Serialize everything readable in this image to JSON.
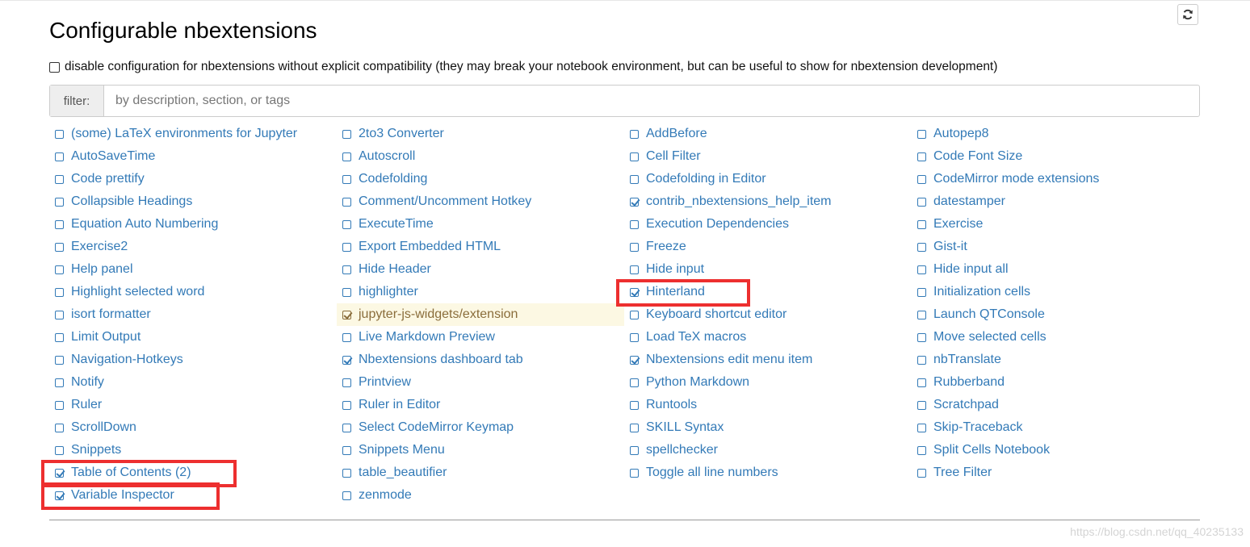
{
  "page": {
    "title": "Configurable nbextensions",
    "refresh_icon": "refresh-icon"
  },
  "disable_option": {
    "checked": false,
    "label": "disable configuration for nbextensions without explicit compatibility (they may break your notebook environment, but can be useful to show for nbextension development)"
  },
  "filter": {
    "label": "filter:",
    "placeholder": "by description, section, or tags",
    "value": ""
  },
  "colors": {
    "link": "#337ab7",
    "warning_bg": "#fcf8e3",
    "warning_text": "#8a6d3b",
    "highlight_box": "#ed2f2f"
  },
  "extensions": [
    {
      "label": "(some) LaTeX environments for Jupyter",
      "checked": false
    },
    {
      "label": "2to3 Converter",
      "checked": false
    },
    {
      "label": "AddBefore",
      "checked": false
    },
    {
      "label": "Autopep8",
      "checked": false
    },
    {
      "label": "AutoSaveTime",
      "checked": false
    },
    {
      "label": "Autoscroll",
      "checked": false
    },
    {
      "label": "Cell Filter",
      "checked": false
    },
    {
      "label": "Code Font Size",
      "checked": false
    },
    {
      "label": "Code prettify",
      "checked": false
    },
    {
      "label": "Codefolding",
      "checked": false
    },
    {
      "label": "Codefolding in Editor",
      "checked": false
    },
    {
      "label": "CodeMirror mode extensions",
      "checked": false
    },
    {
      "label": "Collapsible Headings",
      "checked": false
    },
    {
      "label": "Comment/Uncomment Hotkey",
      "checked": false
    },
    {
      "label": "contrib_nbextensions_help_item",
      "checked": true
    },
    {
      "label": "datestamper",
      "checked": false
    },
    {
      "label": "Equation Auto Numbering",
      "checked": false
    },
    {
      "label": "ExecuteTime",
      "checked": false
    },
    {
      "label": "Execution Dependencies",
      "checked": false
    },
    {
      "label": "Exercise",
      "checked": false
    },
    {
      "label": "Exercise2",
      "checked": false
    },
    {
      "label": "Export Embedded HTML",
      "checked": false
    },
    {
      "label": "Freeze",
      "checked": false
    },
    {
      "label": "Gist-it",
      "checked": false
    },
    {
      "label": "Help panel",
      "checked": false
    },
    {
      "label": "Hide Header",
      "checked": false
    },
    {
      "label": "Hide input",
      "checked": false
    },
    {
      "label": "Hide input all",
      "checked": false
    },
    {
      "label": "Highlight selected word",
      "checked": false
    },
    {
      "label": "highlighter",
      "checked": false
    },
    {
      "label": "Hinterland",
      "checked": true,
      "highlighted": true
    },
    {
      "label": "Initialization cells",
      "checked": false
    },
    {
      "label": "isort formatter",
      "checked": false
    },
    {
      "label": "jupyter-js-widgets/extension",
      "checked": true,
      "warning": true
    },
    {
      "label": "Keyboard shortcut editor",
      "checked": false
    },
    {
      "label": "Launch QTConsole",
      "checked": false
    },
    {
      "label": "Limit Output",
      "checked": false
    },
    {
      "label": "Live Markdown Preview",
      "checked": false
    },
    {
      "label": "Load TeX macros",
      "checked": false
    },
    {
      "label": "Move selected cells",
      "checked": false
    },
    {
      "label": "Navigation-Hotkeys",
      "checked": false
    },
    {
      "label": "Nbextensions dashboard tab",
      "checked": true
    },
    {
      "label": "Nbextensions edit menu item",
      "checked": true
    },
    {
      "label": "nbTranslate",
      "checked": false
    },
    {
      "label": "Notify",
      "checked": false
    },
    {
      "label": "Printview",
      "checked": false
    },
    {
      "label": "Python Markdown",
      "checked": false
    },
    {
      "label": "Rubberband",
      "checked": false
    },
    {
      "label": "Ruler",
      "checked": false
    },
    {
      "label": "Ruler in Editor",
      "checked": false
    },
    {
      "label": "Runtools",
      "checked": false
    },
    {
      "label": "Scratchpad",
      "checked": false
    },
    {
      "label": "ScrollDown",
      "checked": false
    },
    {
      "label": "Select CodeMirror Keymap",
      "checked": false
    },
    {
      "label": "SKILL Syntax",
      "checked": false
    },
    {
      "label": "Skip-Traceback",
      "checked": false
    },
    {
      "label": "Snippets",
      "checked": false
    },
    {
      "label": "Snippets Menu",
      "checked": false
    },
    {
      "label": "spellchecker",
      "checked": false
    },
    {
      "label": "Split Cells Notebook",
      "checked": false
    },
    {
      "label": "Table of Contents (2)",
      "checked": true,
      "highlighted": true
    },
    {
      "label": "table_beautifier",
      "checked": false
    },
    {
      "label": "Toggle all line numbers",
      "checked": false
    },
    {
      "label": "Tree Filter",
      "checked": false
    },
    {
      "label": "Variable Inspector",
      "checked": true,
      "highlighted": true
    },
    {
      "label": "zenmode",
      "checked": false
    }
  ],
  "watermark": "https://blog.csdn.net/qq_40235133"
}
